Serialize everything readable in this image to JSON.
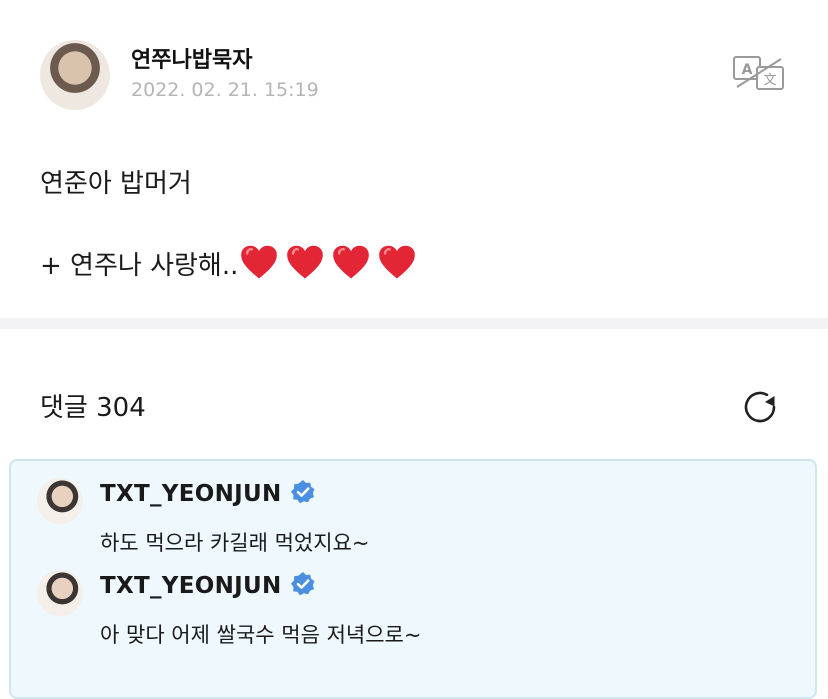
{
  "post": {
    "author": "연쭈나밥묵자",
    "timestamp": "2022. 02. 21. 15:19",
    "translate_icon": "translate-icon",
    "lines": [
      "연준아 밥머거",
      "+ 연주나 사랑해.."
    ],
    "hearts": [
      "❤️",
      "❤️",
      "❤️",
      "❤️"
    ],
    "heart_color": "#e32636"
  },
  "comments": {
    "label": "댓글 304",
    "refresh_icon": "refresh-icon",
    "items": [
      {
        "author": "TXT_YEONJUN",
        "verified": true,
        "text": "하도 먹으라 카길래 먹었지요~"
      },
      {
        "author": "TXT_YEONJUN",
        "verified": true,
        "text": "아 맞다 어제 쌀국수 먹음 저녁으로~"
      }
    ],
    "highlight_bg": "#eef8fd",
    "verified_color": "#4a8fe0"
  }
}
